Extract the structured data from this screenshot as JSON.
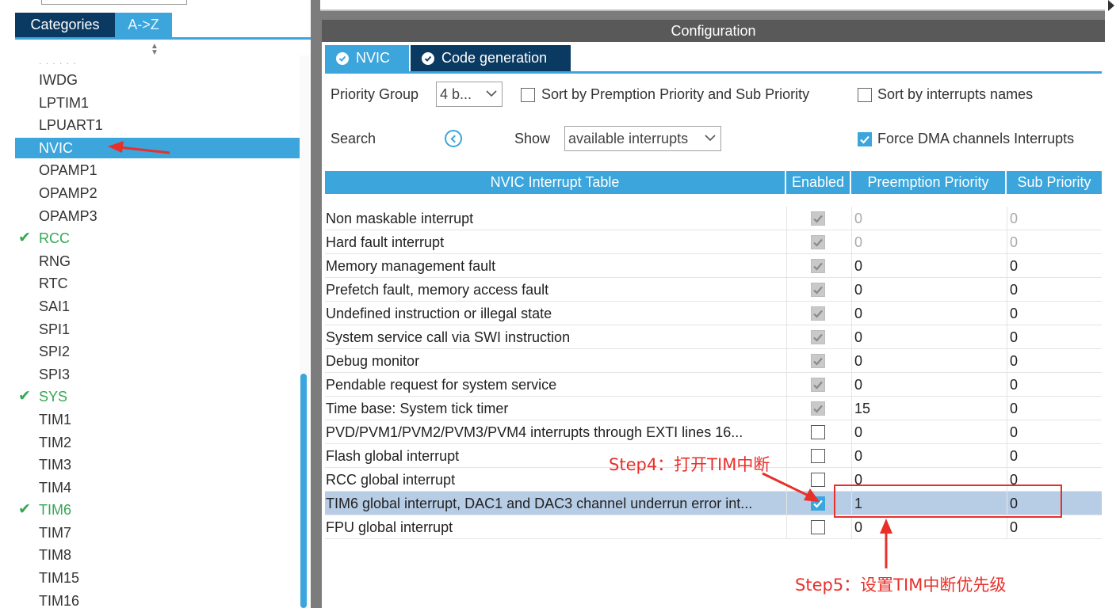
{
  "left": {
    "tabs": [
      "Categories",
      "A->Z"
    ],
    "ellipsis": ". . . . . .",
    "items": [
      {
        "label": "IWDG",
        "state": "normal"
      },
      {
        "label": "LPTIM1",
        "state": "normal"
      },
      {
        "label": "LPUART1",
        "state": "normal"
      },
      {
        "label": "NVIC",
        "state": "selected"
      },
      {
        "label": "OPAMP1",
        "state": "normal"
      },
      {
        "label": "OPAMP2",
        "state": "normal"
      },
      {
        "label": "OPAMP3",
        "state": "normal"
      },
      {
        "label": "RCC",
        "state": "configured"
      },
      {
        "label": "RNG",
        "state": "normal"
      },
      {
        "label": "RTC",
        "state": "normal"
      },
      {
        "label": "SAI1",
        "state": "normal"
      },
      {
        "label": "SPI1",
        "state": "normal"
      },
      {
        "label": "SPI2",
        "state": "normal"
      },
      {
        "label": "SPI3",
        "state": "normal"
      },
      {
        "label": "SYS",
        "state": "configured"
      },
      {
        "label": "TIM1",
        "state": "normal"
      },
      {
        "label": "TIM2",
        "state": "normal"
      },
      {
        "label": "TIM3",
        "state": "normal"
      },
      {
        "label": "TIM4",
        "state": "normal"
      },
      {
        "label": "TIM6",
        "state": "configured"
      },
      {
        "label": "TIM7",
        "state": "normal"
      },
      {
        "label": "TIM8",
        "state": "normal"
      },
      {
        "label": "TIM15",
        "state": "normal"
      },
      {
        "label": "TIM16",
        "state": "normal"
      }
    ]
  },
  "config": {
    "title": "Configuration",
    "tabs": {
      "nvic": "NVIC",
      "codegen": "Code generation"
    },
    "priority_group_label": "Priority Group",
    "priority_group_value": "4 b...",
    "sort_premption_label": "Sort by Premption Priority and Sub Priority",
    "sort_names_label": "Sort by interrupts names",
    "search_label": "Search",
    "show_label": "Show",
    "show_value": "available interrupts",
    "force_dma_label": "Force DMA channels Interrupts",
    "force_dma_checked": true
  },
  "table": {
    "headers": {
      "name": "NVIC Interrupt Table",
      "enabled": "Enabled",
      "preemption": "Preemption Priority",
      "sub": "Sub Priority"
    },
    "rows": [
      {
        "name": "Non maskable interrupt",
        "enabled": true,
        "locked": true,
        "preemption": "0",
        "sub": "0",
        "muted": true
      },
      {
        "name": "Hard fault interrupt",
        "enabled": true,
        "locked": true,
        "preemption": "0",
        "sub": "0",
        "muted": true
      },
      {
        "name": "Memory management fault",
        "enabled": true,
        "locked": true,
        "preemption": "0",
        "sub": "0",
        "muted": false
      },
      {
        "name": "Prefetch fault, memory access fault",
        "enabled": true,
        "locked": true,
        "preemption": "0",
        "sub": "0",
        "muted": false
      },
      {
        "name": "Undefined instruction or illegal state",
        "enabled": true,
        "locked": true,
        "preemption": "0",
        "sub": "0",
        "muted": false
      },
      {
        "name": "System service call via SWI instruction",
        "enabled": true,
        "locked": true,
        "preemption": "0",
        "sub": "0",
        "muted": false
      },
      {
        "name": "Debug monitor",
        "enabled": true,
        "locked": true,
        "preemption": "0",
        "sub": "0",
        "muted": false
      },
      {
        "name": "Pendable request for system service",
        "enabled": true,
        "locked": true,
        "preemption": "0",
        "sub": "0",
        "muted": false
      },
      {
        "name": "Time base: System tick timer",
        "enabled": true,
        "locked": true,
        "preemption": "15",
        "sub": "0",
        "muted": false
      },
      {
        "name": "PVD/PVM1/PVM2/PVM3/PVM4 interrupts through EXTI lines 16...",
        "enabled": false,
        "locked": false,
        "preemption": "0",
        "sub": "0",
        "muted": false
      },
      {
        "name": "Flash global interrupt",
        "enabled": false,
        "locked": false,
        "preemption": "0",
        "sub": "0",
        "muted": false
      },
      {
        "name": "RCC global interrupt",
        "enabled": false,
        "locked": false,
        "preemption": "0",
        "sub": "0",
        "muted": false
      },
      {
        "name": "TIM6 global interrupt, DAC1 and DAC3 channel underrun error int...",
        "enabled": true,
        "locked": false,
        "preemption": "1",
        "sub": "0",
        "muted": false,
        "highlight": true
      },
      {
        "name": "FPU global interrupt",
        "enabled": false,
        "locked": false,
        "preemption": "0",
        "sub": "0",
        "muted": false
      }
    ]
  },
  "annotations": {
    "step4": "Step4：打开TIM中断",
    "step5": "Step5：设置TIM中断优先级",
    "color": "#e8302a"
  },
  "colors": {
    "accent": "#3ba5dc",
    "dark_tab": "#0a3a61",
    "header": "#595959",
    "ok_green": "#34a853",
    "highlight_row": "#b7cde6"
  }
}
